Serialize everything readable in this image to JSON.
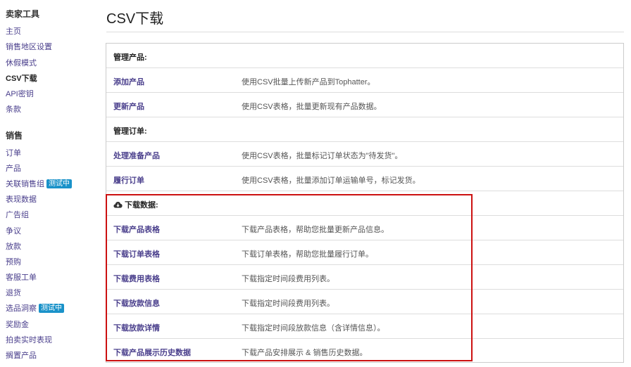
{
  "sidebar": {
    "section1_heading": "卖家工具",
    "section1_items": [
      {
        "label": "主页"
      },
      {
        "label": "销售地区设置"
      },
      {
        "label": "休假模式"
      },
      {
        "label": "CSV下载"
      },
      {
        "label": "API密钥"
      },
      {
        "label": "条款"
      }
    ],
    "section2_heading": "销售",
    "section2_items": [
      {
        "label": "订单"
      },
      {
        "label": "产品"
      },
      {
        "label": "关联销售组",
        "badge": "测试中"
      },
      {
        "label": "表现数据"
      },
      {
        "label": "广告组"
      },
      {
        "label": "争议"
      },
      {
        "label": "放款"
      },
      {
        "label": "预购"
      },
      {
        "label": "客服工单"
      },
      {
        "label": "退货"
      },
      {
        "label": "选品洞察",
        "badge": "测试中"
      },
      {
        "label": "奖励金"
      },
      {
        "label": "拍卖实时表现"
      },
      {
        "label": "搁置产品"
      }
    ]
  },
  "page_title": "CSV下载",
  "table": {
    "manage_products_heading": "管理产品:",
    "manage_products_rows": [
      {
        "name": "添加产品",
        "desc": "使用CSV批量上传新产品到Tophatter。"
      },
      {
        "name": "更新产品",
        "desc": "使用CSV表格，批量更新现有产品数据。"
      }
    ],
    "manage_orders_heading": "管理订单:",
    "manage_orders_rows": [
      {
        "name": "处理准备产品",
        "desc": "使用CSV表格，批量标记订单状态为\"待发货\"。"
      },
      {
        "name": "履行订单",
        "desc": "使用CSV表格，批量添加订单运输单号，标记发货。"
      }
    ],
    "download_heading": "下载数据:",
    "download_rows": [
      {
        "name": "下载产品表格",
        "desc": "下载产品表格，帮助您批量更新产品信息。"
      },
      {
        "name": "下载订单表格",
        "desc": "下载订单表格，帮助您批量履行订单。"
      },
      {
        "name": "下载费用表格",
        "desc": "下载指定时间段费用列表。"
      },
      {
        "name": "下载放款信息",
        "desc": "下载指定时间段费用列表。"
      },
      {
        "name": "下载放款详情",
        "desc": "下载指定时间段放款信息（含详情信息）。"
      },
      {
        "name": "下载产品展示历史数据",
        "desc": "下载产品安排展示 & 销售历史数据。"
      }
    ]
  },
  "colors": {
    "link": "#4a3f8c",
    "badge": "#1a92c9",
    "highlight": "#cc1111"
  }
}
